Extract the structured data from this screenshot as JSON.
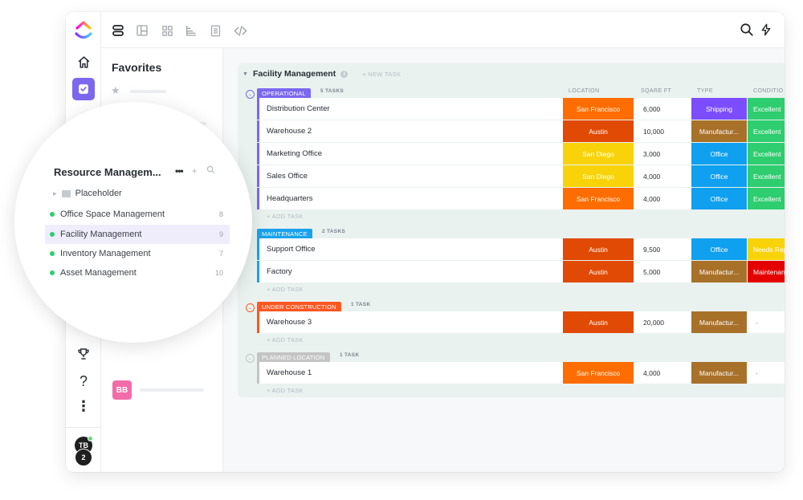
{
  "app": {
    "rail": {
      "logo": "clickup-logo-icon",
      "items": [
        {
          "icon": "home-icon"
        },
        {
          "icon": "tasks-checkbox-icon",
          "active": true
        },
        {
          "icon": "refresh-icon"
        },
        {
          "icon": "trophy-icon"
        },
        {
          "icon": "help-icon",
          "glyph": "?"
        },
        {
          "icon": "more-vertical-icon",
          "glyph": "⋮"
        }
      ],
      "user_avatar": "TB",
      "notification_badge": "2"
    },
    "toolbar": {
      "views": [
        "list-view-icon",
        "board-view-icon",
        "box-view-icon",
        "gantt-view-icon",
        "doc-view-icon",
        "embed-view-icon"
      ],
      "active_view": "list-view-icon",
      "right_icons": [
        "search-icon",
        "lightning-icon"
      ]
    },
    "sidebar": {
      "favorites_title": "Favorites",
      "bb_avatar": "BB"
    },
    "workspace_popup": {
      "title": "Resource Managem...",
      "more": "•••",
      "add": "+",
      "folder": "Placeholder",
      "lists": [
        {
          "label": "Office Space Management",
          "count": "8"
        },
        {
          "label": "Facility Management",
          "count": "9",
          "selected": true
        },
        {
          "label": "Inventory Management",
          "count": "7"
        },
        {
          "label": "Asset Management",
          "count": "10"
        }
      ]
    },
    "list": {
      "title": "Facility Management",
      "info": "i",
      "new_task": "+ NEW TASK",
      "add_task": "+ ADD TASK",
      "columns": [
        "LOCATION",
        "SQARE FT",
        "TYPE",
        "CONDITIO"
      ],
      "groups": [
        {
          "status": "OPERATIONAL",
          "color": "#7b68ee",
          "count": "5 TASKS",
          "tasks": [
            {
              "name": "Distribution Center",
              "location": "San Francisco",
              "loc_color": "#ff6d00",
              "sqft": "6,000",
              "type": "Shipping",
              "type_color": "#7c4dff",
              "condition": "Excellent",
              "cond_color": "#2ecd6f"
            },
            {
              "name": "Warehouse 2",
              "location": "Austin",
              "loc_color": "#e04a05",
              "sqft": "10,000",
              "type": "Manufactur...",
              "type_color": "#a8712a",
              "condition": "Excellent",
              "cond_color": "#2ecd6f"
            },
            {
              "name": "Marketing Office",
              "location": "San Diego",
              "loc_color": "#f8d30a",
              "sqft": "3,000",
              "type": "Office",
              "type_color": "#0fa0f0",
              "condition": "Excellent",
              "cond_color": "#2ecd6f"
            },
            {
              "name": "Sales Office",
              "location": "San Diego",
              "loc_color": "#f8d30a",
              "sqft": "4,000",
              "type": "Office",
              "type_color": "#0fa0f0",
              "condition": "Excellent",
              "cond_color": "#2ecd6f"
            },
            {
              "name": "Headquarters",
              "location": "San Francisco",
              "loc_color": "#ff6d00",
              "sqft": "4,000",
              "type": "Office",
              "type_color": "#0fa0f0",
              "condition": "Excellent",
              "cond_color": "#2ecd6f"
            }
          ]
        },
        {
          "status": "MAINTENANCE",
          "color": "#1aa3ed",
          "count": "2 TASKS",
          "tasks": [
            {
              "name": "Support Office",
              "location": "Austin",
              "loc_color": "#e04a05",
              "sqft": "9,500",
              "type": "Office",
              "type_color": "#0fa0f0",
              "condition": "Needs Repair",
              "cond_color": "#f8d30a"
            },
            {
              "name": "Factory",
              "location": "Austin",
              "loc_color": "#e04a05",
              "sqft": "5,000",
              "type": "Manufactur...",
              "type_color": "#a8712a",
              "condition": "Maintenance",
              "cond_color": "#e50000"
            }
          ]
        },
        {
          "status": "UNDER CONSTRUCTION",
          "color": "#ff5722",
          "count": "1 TASK",
          "tasks": [
            {
              "name": "Warehouse 3",
              "location": "Austin",
              "loc_color": "#e04a05",
              "sqft": "20,000",
              "type": "Manufactur...",
              "type_color": "#a8712a",
              "condition": "-",
              "cond_color": ""
            }
          ]
        },
        {
          "status": "PLANNED LOCATION",
          "color": "#c4c4c4",
          "count": "1 TASK",
          "tasks": [
            {
              "name": "Warehouse 1",
              "location": "San Francisco",
              "loc_color": "#ff6d00",
              "sqft": "4,000",
              "type": "Manufactur...",
              "type_color": "#a8712a",
              "condition": "-",
              "cond_color": ""
            }
          ]
        }
      ]
    }
  }
}
